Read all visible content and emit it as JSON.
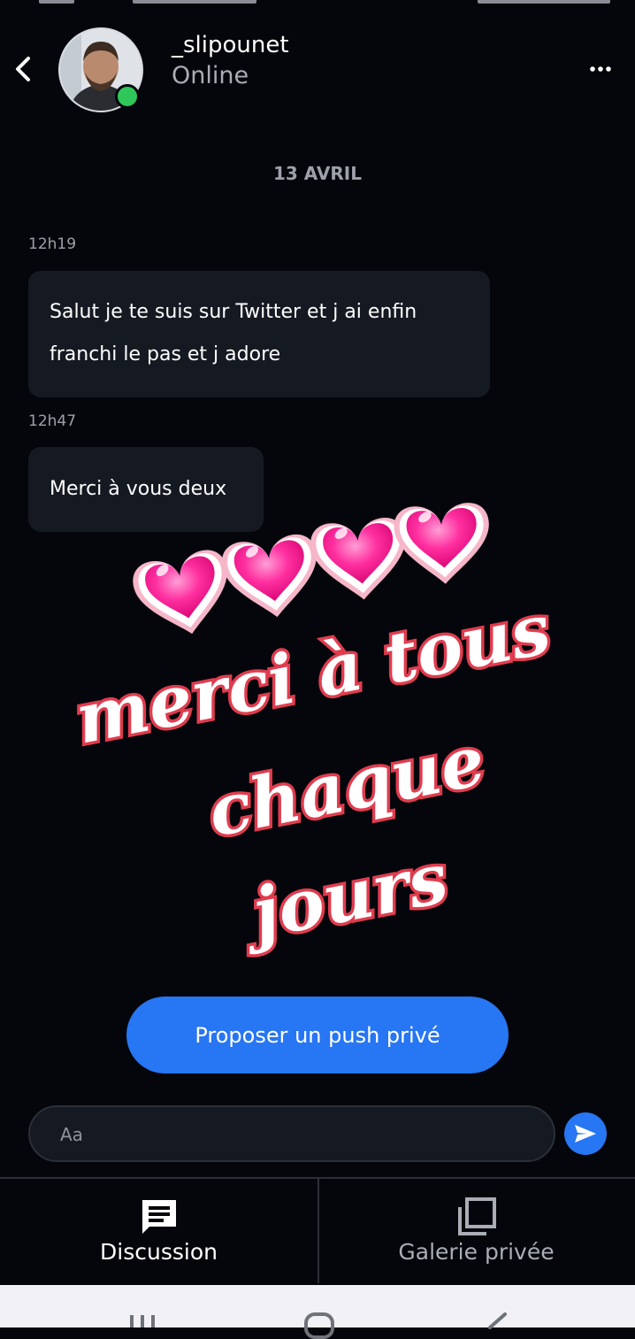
{
  "header": {
    "username": "_slipounet",
    "status": "Online"
  },
  "chat": {
    "date": "13 AVRIL",
    "messages": [
      {
        "time": "12h19",
        "text_line1": "Salut je te suis sur Twitter et j ai enfin",
        "text_line2": "franchi le pas et j adore"
      },
      {
        "time": "12h47",
        "text": "Merci à vous deux"
      }
    ],
    "sticker": {
      "line1": "merci à tous",
      "line2": "chaque",
      "line3": "jours"
    }
  },
  "push_button": {
    "label": "Proposer un push privé"
  },
  "composer": {
    "placeholder": "Aa",
    "value": ""
  },
  "tabs": [
    {
      "label": "Discussion",
      "icon": "message-icon",
      "active": true
    },
    {
      "label": "Galerie privée",
      "icon": "gallery-icon",
      "active": false
    }
  ],
  "colors": {
    "background": "#05060b",
    "bubble": "#151922",
    "accent": "#2776f3",
    "online": "#2fc75a",
    "sticker_heart": "#ff2fa0",
    "sticker_outline": "#e03c4f"
  }
}
